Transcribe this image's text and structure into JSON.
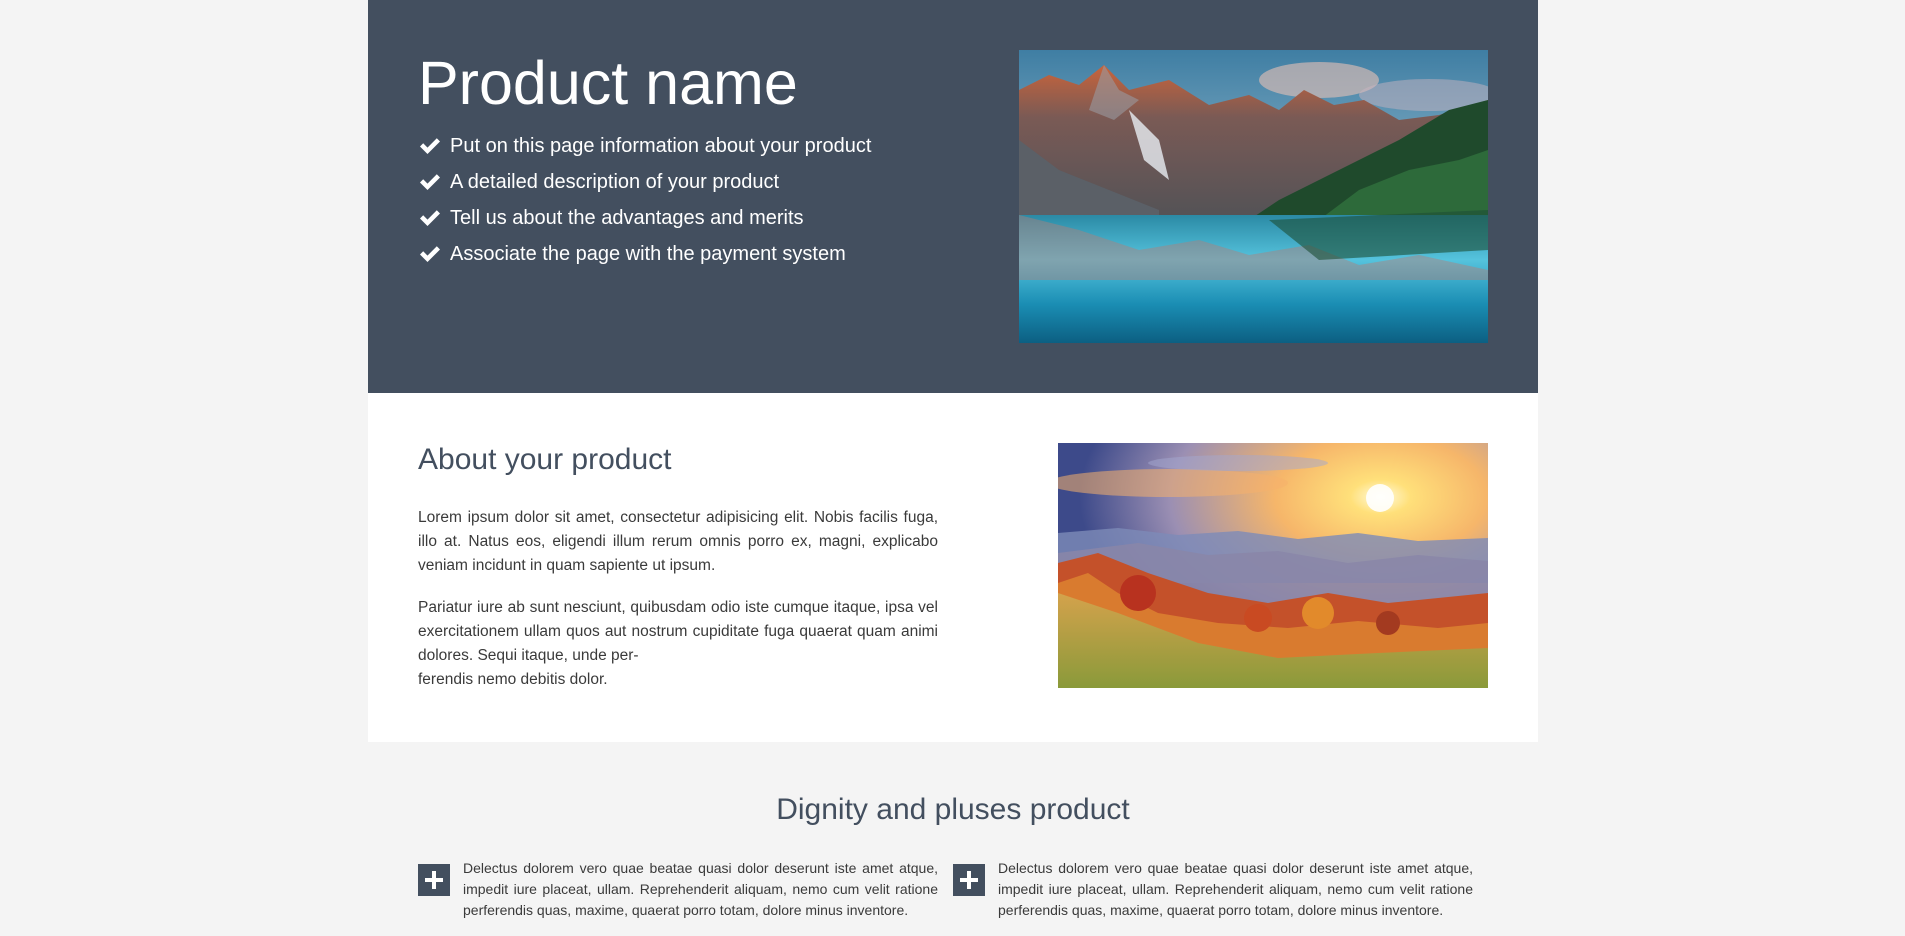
{
  "hero": {
    "title": "Product name",
    "features": [
      "Put on this page information about your product",
      "A detailed description of your product",
      "Tell us about the advantages and merits",
      "Associate the page with the payment system"
    ],
    "image_desc": "mountain-lake-photo"
  },
  "about": {
    "title": "About your product",
    "paragraph1": "Lorem ipsum dolor sit amet, consectetur adipisicing elit. Nobis facilis fuga, illo at. Natus eos, eligendi illum rerum omnis porro ex, magni, explicabo veniam incidunt in quam sapiente ut ipsum.",
    "paragraph2_main": "Pariatur iure ab sunt nesciunt, quibusdam odio iste cumque itaque, ipsa vel exercitationem ullam quos aut nostrum cupiditate fuga quaerat quam animi dolores. Sequi itaque, unde per-",
    "paragraph2_last": "ferendis nemo debitis dolor."
  },
  "dignity": {
    "title": "Dignity and pluses product",
    "items": [
      "Delectus dolorem vero quae beatae quasi dolor deserunt iste amet atque, impedit iure placeat, ullam. Reprehenderit aliquam, nemo cum velit ratione perferendis quas, maxime, quaerat porro totam, dolore minus inventore.",
      "Delectus dolorem vero quae beatae quasi dolor deserunt iste amet atque, impedit iure placeat, ullam. Reprehenderit aliquam, nemo cum velit ratione perferendis quas, maxime, quaerat porro totam, dolore minus inventore."
    ]
  },
  "colors": {
    "hero_bg": "#434f5f",
    "page_bg": "#f4f4f4",
    "accent_text": "#434f5f"
  }
}
